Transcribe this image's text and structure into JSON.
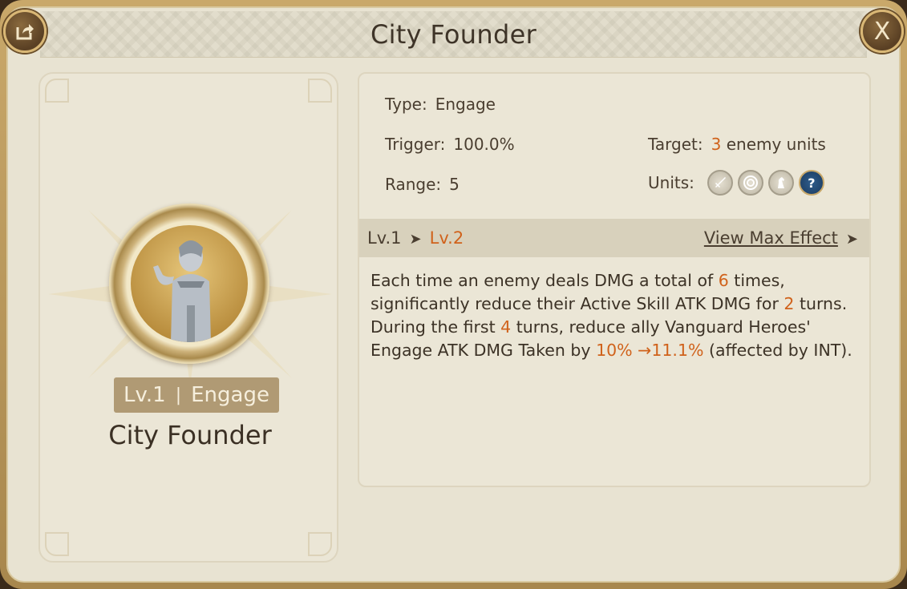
{
  "title": "City Founder",
  "header": {
    "share_icon": "share-icon",
    "close_label": "X"
  },
  "left": {
    "badge_level": "Lv.1",
    "badge_sep": "|",
    "badge_type": "Engage",
    "skill_name": "City Founder"
  },
  "stats": {
    "type_label": "Type:",
    "type_value": "Engage",
    "trigger_label": "Trigger:",
    "trigger_value": "100.0%",
    "range_label": "Range:",
    "range_value": "5",
    "target_label": "Target:",
    "target_count": "3",
    "target_suffix": "enemy units",
    "units_label": "Units:",
    "units": [
      "sword-icon",
      "target-icon",
      "horse-icon",
      "question-icon"
    ],
    "units_question": "?"
  },
  "levels": {
    "current": "Lv.1",
    "next": "Lv.2",
    "view_max": "View Max Effect"
  },
  "description": {
    "p1": "Each time an enemy deals DMG a total of ",
    "n1": "6",
    "p2": " times, significantly reduce their Active Skill ATK DMG for ",
    "n2": "2",
    "p3": " turns. During the first ",
    "n3": "4",
    "p4": " turns, reduce ally Vanguard Heroes' Engage ATK DMG Taken by ",
    "n4": "10% →11.1%",
    "p5": " (affected by INT)."
  },
  "colors": {
    "highlight": "#d0621b",
    "frame": "#c9a86a",
    "panel": "#e8e3d2"
  }
}
